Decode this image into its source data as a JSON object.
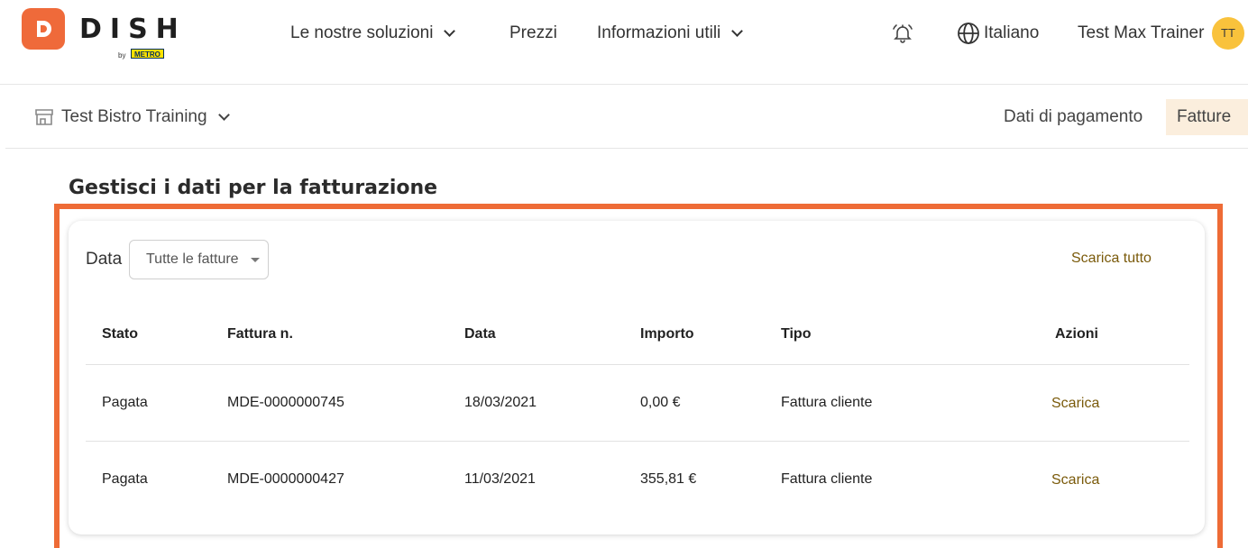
{
  "brand": {
    "name": "DISH",
    "by": "by",
    "partner": "METRO"
  },
  "nav": {
    "items": [
      {
        "label": "Le nostre soluzioni",
        "dropdown": true
      },
      {
        "label": "Prezzi",
        "dropdown": false
      },
      {
        "label": "Informazioni utili",
        "dropdown": true
      }
    ],
    "language": "Italiano",
    "user_name": "Test Max Trainer",
    "user_initials": "TT"
  },
  "subnav": {
    "store": "Test Bistro Training",
    "tabs": [
      {
        "label": "Dati di pagamento",
        "active": false
      },
      {
        "label": "Fatture",
        "active": true
      }
    ]
  },
  "main": {
    "title": "Gestisci i dati per la fatturazione",
    "filter_label": "Data",
    "filter_value": "Tutte le fatture",
    "download_all": "Scarica tutto",
    "columns": [
      "Stato",
      "Fattura n.",
      "Data",
      "Importo",
      "Tipo",
      "Azioni"
    ],
    "rows": [
      {
        "status": "Pagata",
        "number": "MDE-0000000745",
        "date": "18/03/2021",
        "amount": "0,00 €",
        "type": "Fattura cliente",
        "action": "Scarica"
      },
      {
        "status": "Pagata",
        "number": "MDE-0000000427",
        "date": "11/03/2021",
        "amount": "355,81 €",
        "type": "Fattura cliente",
        "action": "Scarica"
      }
    ]
  },
  "colors": {
    "brand_orange": "#ef6a3a",
    "highlight": "#ee6b36",
    "link": "#7a5a0a",
    "active_tab_bg": "#fbeedd",
    "avatar": "#f9c23c"
  }
}
